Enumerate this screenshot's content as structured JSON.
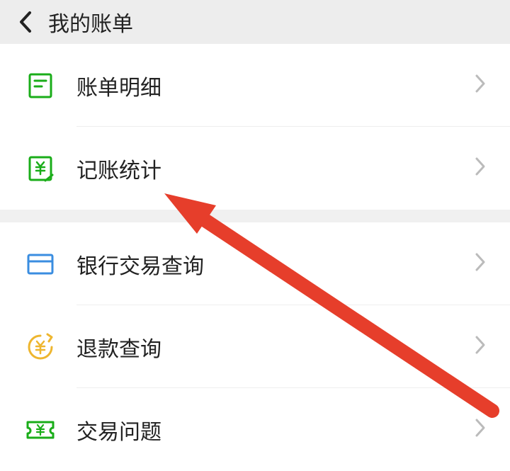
{
  "header": {
    "title": "我的账单"
  },
  "sections": [
    {
      "items": [
        {
          "label": "账单明细"
        },
        {
          "label": "记账统计"
        }
      ]
    },
    {
      "items": [
        {
          "label": "银行交易查询"
        },
        {
          "label": "退款查询"
        },
        {
          "label": "交易问题"
        }
      ]
    }
  ]
}
